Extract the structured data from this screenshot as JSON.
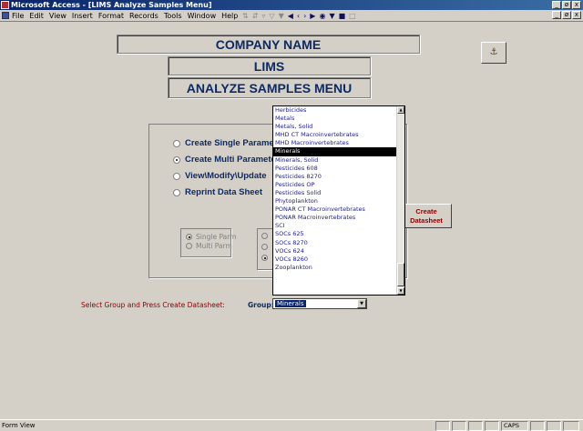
{
  "window": {
    "title": "Microsoft Access - [LIMS Analyze Samples Menu]",
    "buttons": {
      "minimize": "_",
      "restore": "ø",
      "close": "x"
    }
  },
  "menu": {
    "items": [
      "File",
      "Edit",
      "View",
      "Insert",
      "Format",
      "Records",
      "Tools",
      "Window",
      "Help"
    ]
  },
  "form": {
    "company_name": "COMPANY NAME",
    "app_name": "LIMS",
    "menu_title": "ANALYZE SAMPLES MENU",
    "options": {
      "create_single": "Create Single Parameter",
      "create_multi": "Create Multi Parameter",
      "view_modify": "View\\Modify\\Update",
      "reprint": "Reprint Data Sheet"
    },
    "sub_options": {
      "single_parm": "Single Parm",
      "multi_parm": "Multi Parm"
    },
    "create_button": {
      "line1": "Create",
      "line2": "Datasheet"
    },
    "instruction": "Select Group and Press Create Datasheet:",
    "group_label": "Group:",
    "group_value": "Minerals"
  },
  "dropdown": {
    "items": [
      "Herbicides",
      "Metals",
      "Metals, Solid",
      "MHD CT Macroinvertebrates",
      "MHD Macroinvertebrates",
      "Minerals",
      "Minerals, Solid",
      "Pesticides 608",
      "Pesticides 8270",
      "Pesticides OP",
      "Pesticides Solid",
      "Phytoplankton",
      "PONAR CT Macroinvertebrates",
      "PONAR Macroinvertebrates",
      "SCI",
      "SOCs 625",
      "SOCs 8270",
      "VOCs 624",
      "VOCs 8260",
      "Zooplankton"
    ],
    "selected": "Minerals"
  },
  "statusbar": {
    "text": "Form View",
    "caps": "CAPS"
  }
}
